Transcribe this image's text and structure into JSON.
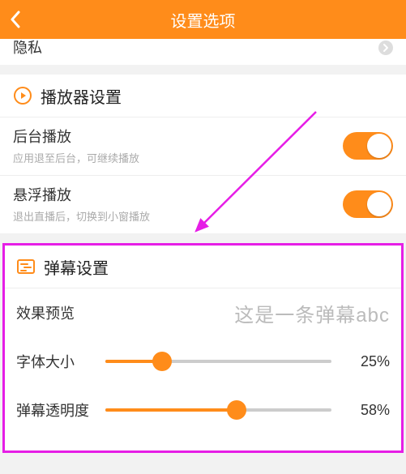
{
  "header": {
    "title": "设置选项"
  },
  "partial": {
    "label": "隐私"
  },
  "player_section": {
    "icon": "play-circle-icon",
    "title": "播放器设置",
    "rows": [
      {
        "main": "后台播放",
        "sub": "应用退至后台，可继续播放",
        "on": true
      },
      {
        "main": "悬浮播放",
        "sub": "退出直播后，切换到小窗播放",
        "on": true
      }
    ]
  },
  "danmu_section": {
    "icon": "danmu-icon",
    "title": "弹幕设置",
    "preview": {
      "label": "效果预览",
      "sample": "这是一条弹幕abc"
    },
    "sliders": [
      {
        "label": "字体大小",
        "value_pct": 25,
        "value_text": "25%"
      },
      {
        "label": "弹幕透明度",
        "value_pct": 58,
        "value_text": "58%"
      }
    ]
  },
  "colors": {
    "accent": "#ff8c1a",
    "highlight": "#e61ee6"
  }
}
